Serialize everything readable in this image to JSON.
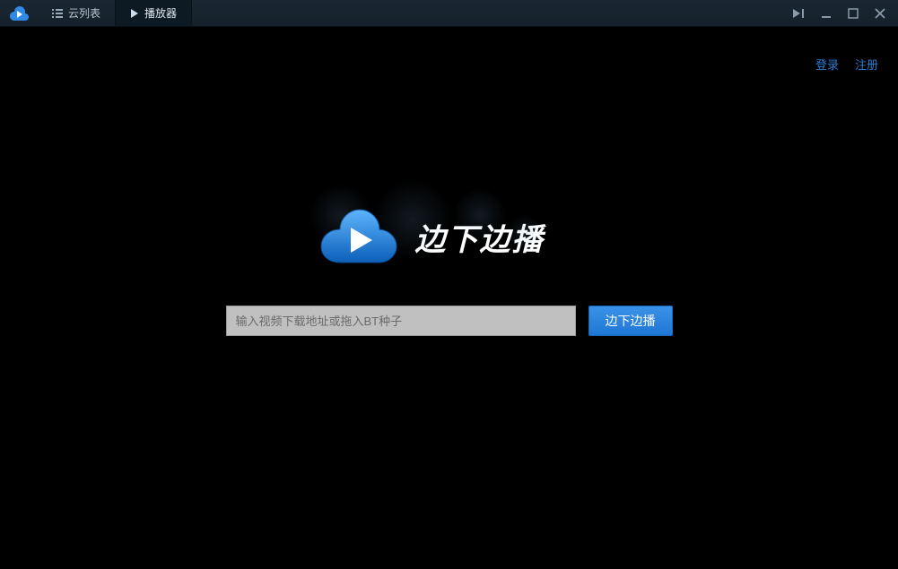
{
  "tabs": {
    "cloud_list": "云列表",
    "player": "播放器"
  },
  "auth": {
    "login": "登录",
    "register": "注册"
  },
  "logo": {
    "title": "边下边播"
  },
  "search": {
    "placeholder": "输入视频下载地址或拖入BT种子",
    "button": "边下边播"
  }
}
